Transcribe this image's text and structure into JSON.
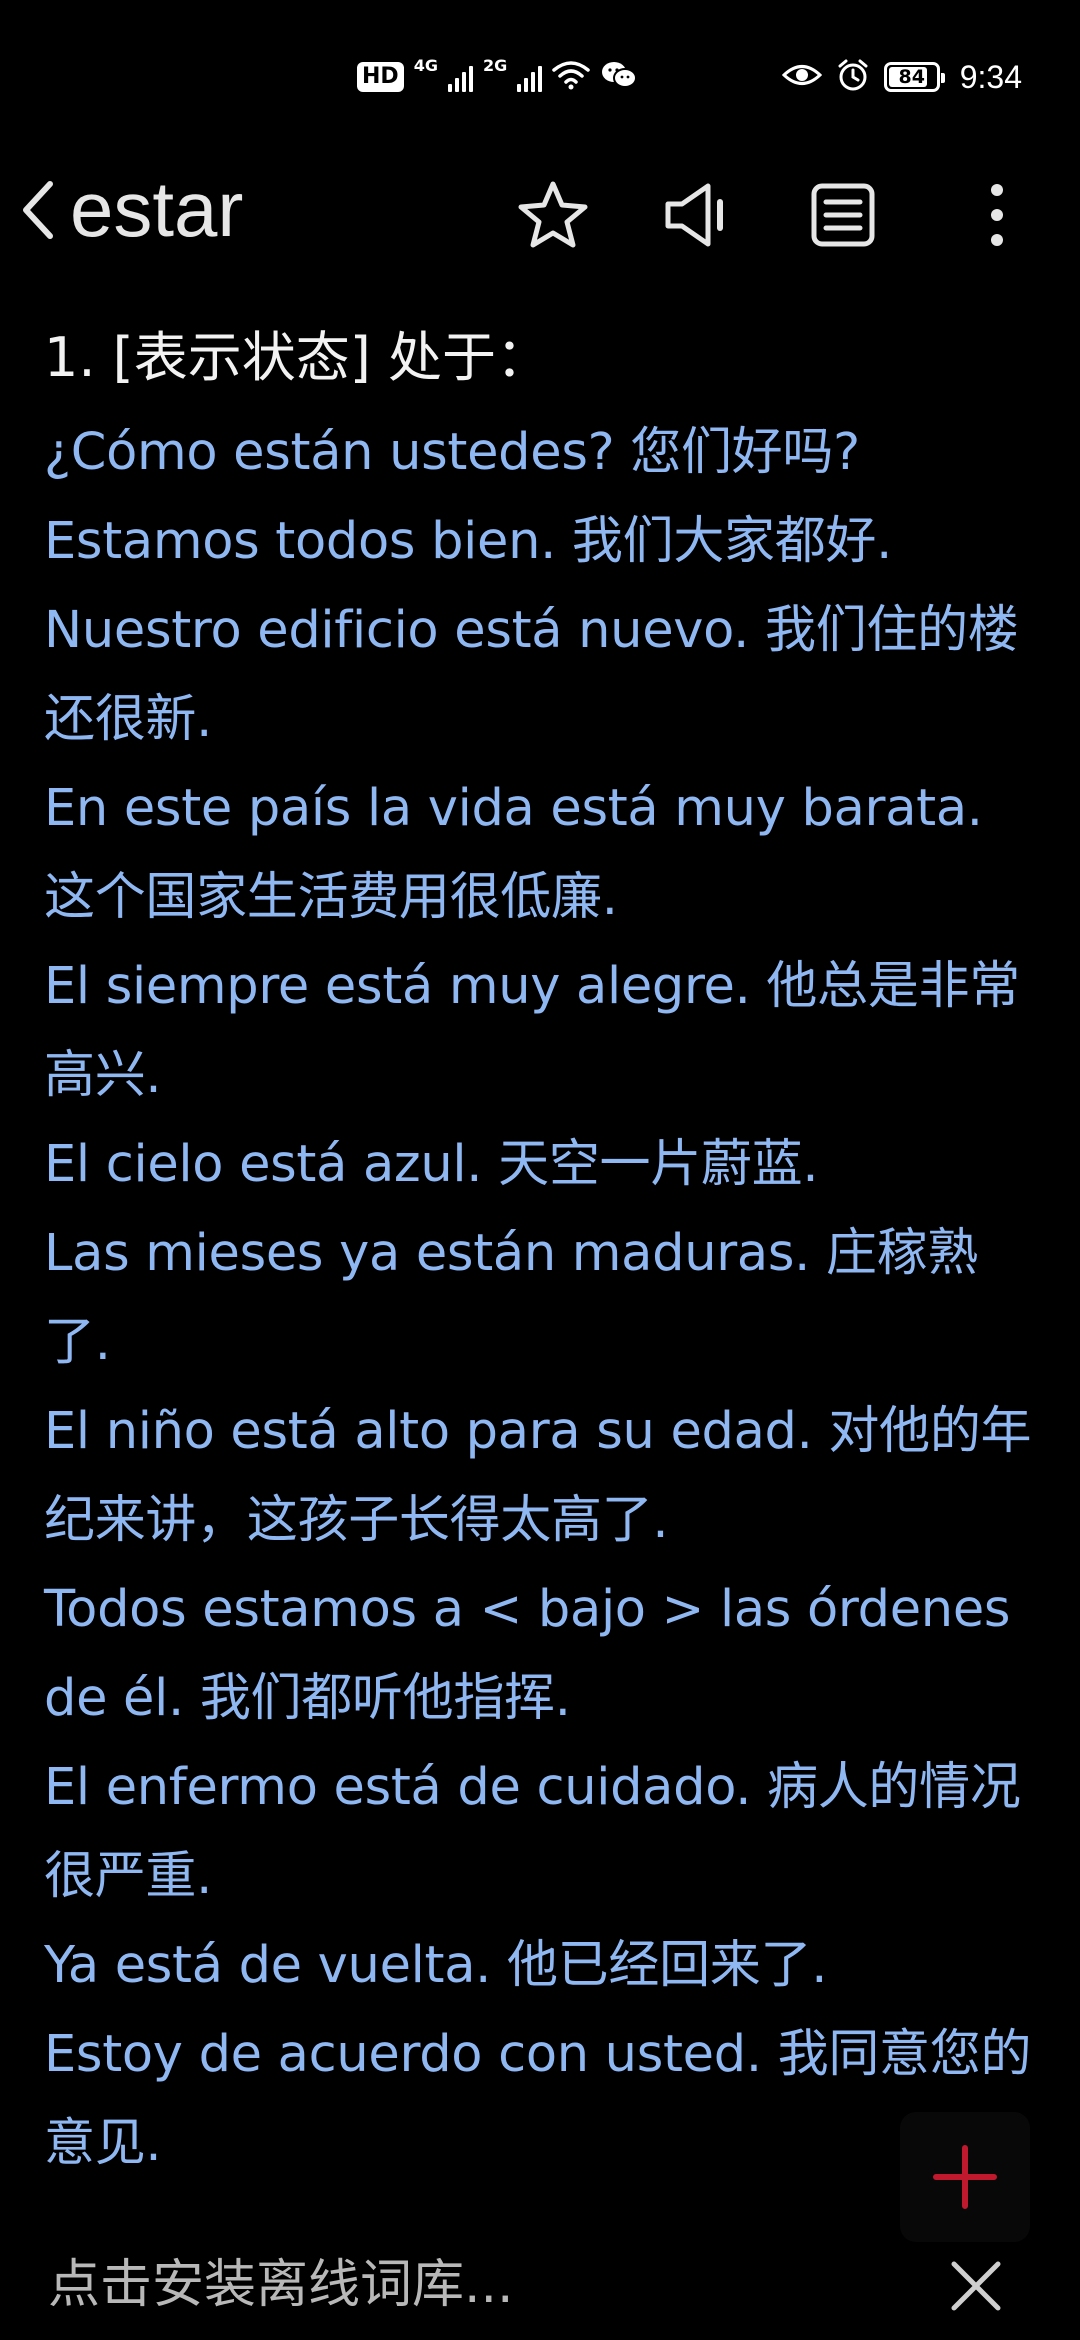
{
  "status_bar": {
    "hd_label": "HD",
    "net1_label": "4G",
    "net2_label": "2G",
    "battery_level": 84,
    "battery_text": "84",
    "time": "9:34",
    "icons": [
      "hd-icon",
      "signal-4g-icon",
      "signal-2g-icon",
      "wifi-icon",
      "wechat-icon",
      "eye-icon",
      "alarm-icon",
      "battery-icon"
    ]
  },
  "toolbar": {
    "title": "estar",
    "back_icon": "chevron-left-icon",
    "actions": [
      "star-icon",
      "speaker-icon",
      "list-icon",
      "more-vertical-icon"
    ]
  },
  "entry": {
    "heading": "1. [表示状态] 处于：",
    "examples": [
      "¿Cómo están ustedes? 您们好吗?",
      "Estamos todos bien. 我们大家都好.",
      "Nuestro edificio está nuevo. 我们住的楼还很新.",
      "En este país la vida está muy barata. 这个国家生活费用很低廉.",
      "El siempre está muy alegre. 他总是非常高兴.",
      "El cielo está azul. 天空一片蔚蓝.",
      "Las mieses ya están maduras. 庄稼熟了.",
      "El niño está alto para su edad. 对他的年纪来讲，这孩子长得太高了.",
      "Todos estamos a < bajo > las órdenes de él. 我们都听他指挥.",
      "El enfermo está de cuidado. 病人的情况很严重.",
      "Ya está de vuelta. 他已经回来了.",
      "Estoy de acuerdo con usted. 我同意您的意见."
    ]
  },
  "bottom_bar": {
    "install_text": "点击安装离线词库...",
    "close_icon": "close-icon",
    "fab_icon": "plus-icon"
  },
  "colors": {
    "background": "#000000",
    "example_text": "#8fb8f2",
    "fab_plus": "#c0182d"
  }
}
